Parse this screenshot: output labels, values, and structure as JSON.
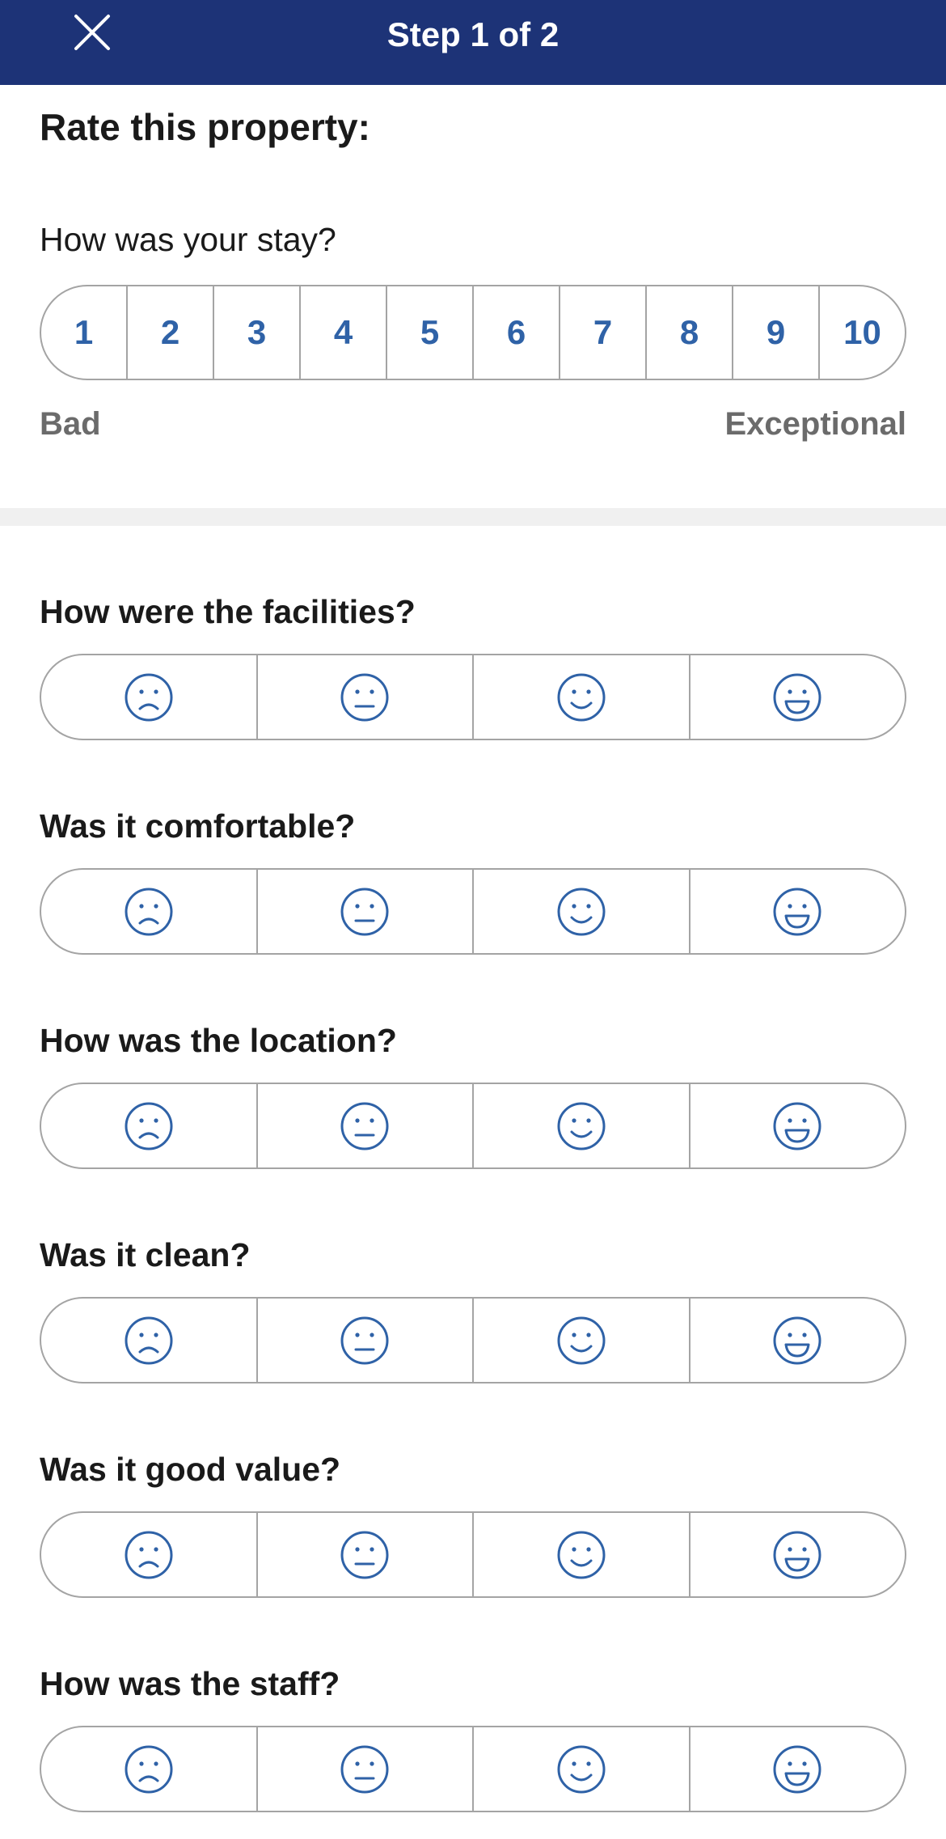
{
  "header": {
    "title": "Step 1 of 2",
    "close_icon": "close-icon",
    "background_color": "#1d3377"
  },
  "page": {
    "title": "Rate this property:"
  },
  "overall": {
    "question": "How was your stay?",
    "options": [
      "1",
      "2",
      "3",
      "4",
      "5",
      "6",
      "7",
      "8",
      "9",
      "10"
    ],
    "label_low": "Bad",
    "label_high": "Exceptional",
    "accent_color": "#2f62a7"
  },
  "face_icons": [
    "sad-face-icon",
    "neutral-face-icon",
    "smile-face-icon",
    "grin-face-icon"
  ],
  "categories": [
    {
      "question": "How were the facilities?"
    },
    {
      "question": "Was it comfortable?"
    },
    {
      "question": "How was the location?"
    },
    {
      "question": "Was it clean?"
    },
    {
      "question": "Was it good value?"
    },
    {
      "question": "How was the staff?"
    }
  ]
}
